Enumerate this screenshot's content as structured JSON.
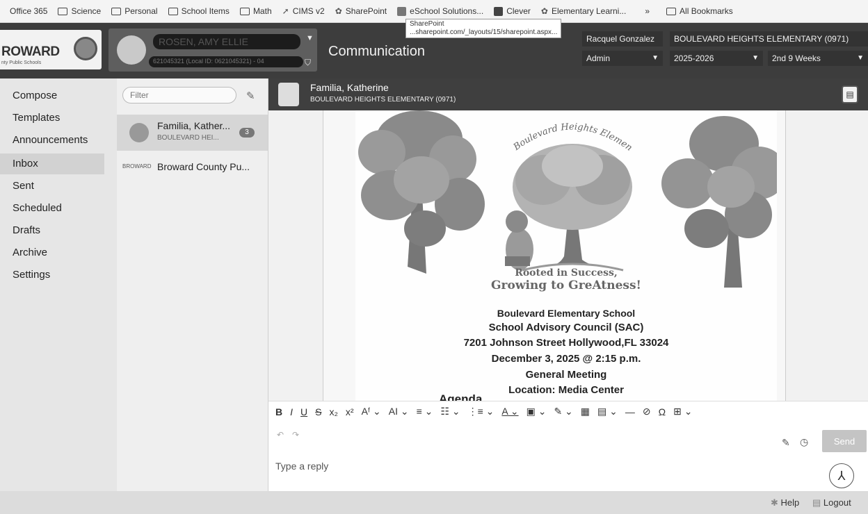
{
  "bookmarks": {
    "items": [
      {
        "label": "Office 365",
        "icon": "none"
      },
      {
        "label": "Science",
        "icon": "folder-icon"
      },
      {
        "label": "Personal",
        "icon": "folder-icon"
      },
      {
        "label": "School Items",
        "icon": "folder-icon"
      },
      {
        "label": "Math",
        "icon": "folder-icon"
      },
      {
        "label": "CIMS v2",
        "icon": "site-icon"
      },
      {
        "label": "SharePoint",
        "icon": "sharepoint-icon"
      },
      {
        "label": "eSchool Solutions...",
        "icon": "site-icon"
      },
      {
        "label": "Clever",
        "icon": "clever-icon"
      },
      {
        "label": "Elementary Learni...",
        "icon": "site-icon"
      }
    ],
    "more": "»",
    "all_bookmarks": "All Bookmarks",
    "tooltip_title": "SharePoint",
    "tooltip_url": "...sharepoint.com/_layouts/15/sharepoint.aspx..."
  },
  "header": {
    "logo_text": "ROWARD",
    "logo_subtext": "nty Public Schools",
    "student_name": "ROSEN, AMY ELLIE",
    "student_id": "621045321 (Local ID: 0621045321) - 04",
    "page_title": "Communication",
    "user_name": "Racquel Gonzalez",
    "school": "BOULEVARD HEIGHTS ELEMENTARY (0971)",
    "role": "Admin",
    "year": "2025-2026",
    "term": "2nd 9 Weeks"
  },
  "nav": {
    "items": [
      "Compose",
      "Templates",
      "Announcements",
      "Inbox",
      "Sent",
      "Scheduled",
      "Drafts",
      "Archive",
      "Settings"
    ],
    "selected": "Inbox"
  },
  "list": {
    "filter_placeholder": "Filter",
    "conversations": [
      {
        "name": "Familia, Kather...",
        "subtitle": "BOULEVARD HEI...",
        "badge": "3"
      },
      {
        "name": "Broward County Pu...",
        "logo_text": "BROWARD"
      }
    ]
  },
  "conversation": {
    "name": "Familia, Katherine",
    "school": "BOULEVARD HEIGHTS ELEMENTARY (0971)"
  },
  "flyer": {
    "arc_text": "Boulevard Heights Elementary",
    "motto_line1": "Rooted in Success,",
    "motto_line2": "Growing to GreAtness!",
    "lines": [
      "Boulevard Elementary School",
      "School Advisory Council (SAC)",
      "7201 Johnson Street Hollywood,FL 33024",
      "December 3, 2025 @ 2:15 p.m.",
      "General Meeting",
      "Location: Media Center"
    ],
    "agenda": "Agenda"
  },
  "toolbar": {
    "buttons": [
      "B",
      "I",
      "U",
      "S",
      "x₂",
      "x²",
      "Aᶠ ⌄",
      "AI ⌄",
      "≡ ⌄",
      "☷ ⌄",
      "⋮≡ ⌄",
      "A ⌄",
      "▣ ⌄",
      "✎ ⌄",
      "▦",
      "▤ ⌄",
      "—",
      "⊘",
      "Ω",
      "⊞ ⌄"
    ]
  },
  "reply": {
    "placeholder": "Type a reply",
    "send_label": "Send"
  },
  "footer": {
    "help": "Help",
    "logout": "Logout"
  },
  "colors": {
    "header_bg": "#3d3d3d",
    "conversation_header_bg": "#3f3f3f",
    "nav_selected": "#d2d2d2",
    "send_disabled": "#c4c4c4"
  }
}
